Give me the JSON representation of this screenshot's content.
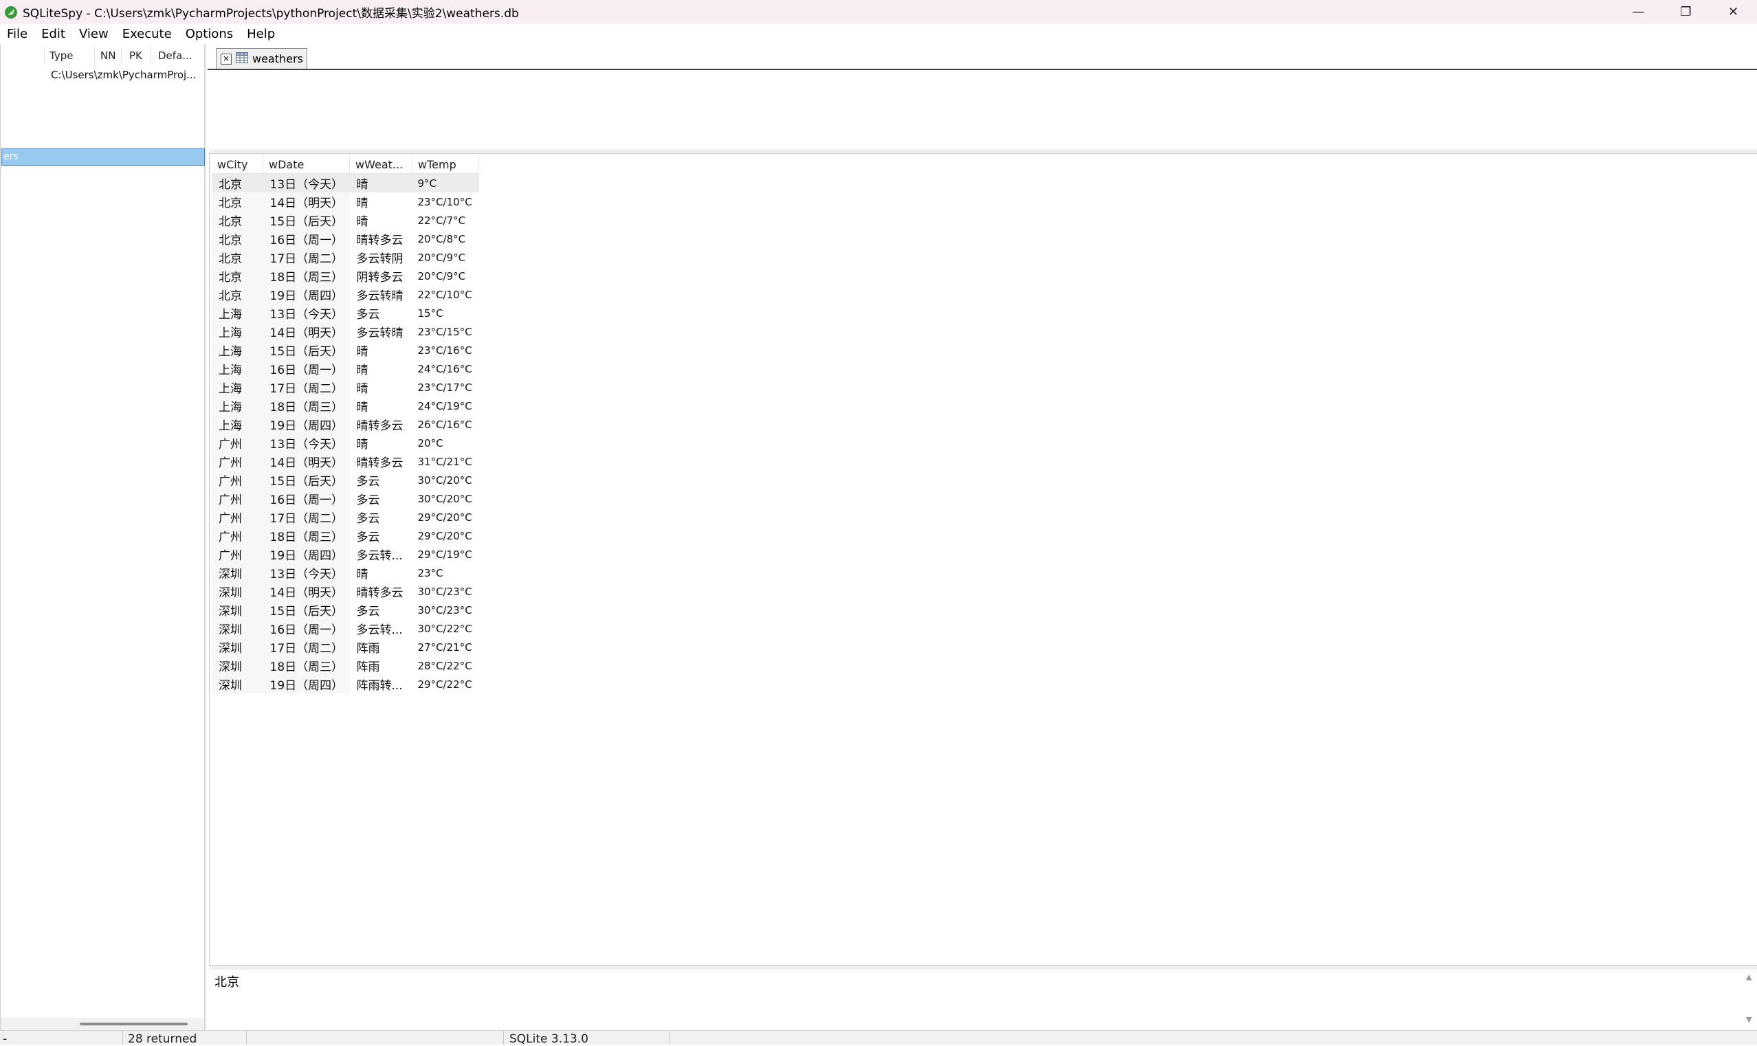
{
  "window": {
    "title": "SQLiteSpy - C:\\Users\\zmk\\PycharmProjects\\pythonProject\\数据采集\\实验2\\weathers.db",
    "minimize_glyph": "—",
    "restore_glyph": "❐",
    "close_glyph": "✕"
  },
  "menu": {
    "items": [
      "File",
      "Edit",
      "View",
      "Execute",
      "Options",
      "Help"
    ]
  },
  "left_pane": {
    "columns": [
      "Type",
      "NN",
      "PK",
      "Defa..."
    ],
    "path": "C:\\Users\\zmk\\PycharmProj...",
    "selected_item": "ers"
  },
  "tab": {
    "close_glyph": "×",
    "label": "weathers"
  },
  "grid": {
    "headers": [
      "wCity",
      "wDate",
      "wWeat...",
      "wTemp"
    ],
    "rows": [
      [
        "北京",
        "13日（今天）",
        "晴",
        "9°C"
      ],
      [
        "北京",
        "14日（明天）",
        "晴",
        "23°C/10°C"
      ],
      [
        "北京",
        "15日（后天）",
        "晴",
        "22°C/7°C"
      ],
      [
        "北京",
        "16日（周一）",
        "晴转多云",
        "20°C/8°C"
      ],
      [
        "北京",
        "17日（周二）",
        "多云转阴",
        "20°C/9°C"
      ],
      [
        "北京",
        "18日（周三）",
        "阴转多云",
        "20°C/9°C"
      ],
      [
        "北京",
        "19日（周四）",
        "多云转晴",
        "22°C/10°C"
      ],
      [
        "上海",
        "13日（今天）",
        "多云",
        "15°C"
      ],
      [
        "上海",
        "14日（明天）",
        "多云转晴",
        "23°C/15°C"
      ],
      [
        "上海",
        "15日（后天）",
        "晴",
        "23°C/16°C"
      ],
      [
        "上海",
        "16日（周一）",
        "晴",
        "24°C/16°C"
      ],
      [
        "上海",
        "17日（周二）",
        "晴",
        "23°C/17°C"
      ],
      [
        "上海",
        "18日（周三）",
        "晴",
        "24°C/19°C"
      ],
      [
        "上海",
        "19日（周四）",
        "晴转多云",
        "26°C/16°C"
      ],
      [
        "广州",
        "13日（今天）",
        "晴",
        "20°C"
      ],
      [
        "广州",
        "14日（明天）",
        "晴转多云",
        "31°C/21°C"
      ],
      [
        "广州",
        "15日（后天）",
        "多云",
        "30°C/20°C"
      ],
      [
        "广州",
        "16日（周一）",
        "多云",
        "30°C/20°C"
      ],
      [
        "广州",
        "17日（周二）",
        "多云",
        "29°C/20°C"
      ],
      [
        "广州",
        "18日（周三）",
        "多云",
        "29°C/20°C"
      ],
      [
        "广州",
        "19日（周四）",
        "多云转...",
        "29°C/19°C"
      ],
      [
        "深圳",
        "13日（今天）",
        "晴",
        "23°C"
      ],
      [
        "深圳",
        "14日（明天）",
        "晴转多云",
        "30°C/23°C"
      ],
      [
        "深圳",
        "15日（后天）",
        "多云",
        "30°C/23°C"
      ],
      [
        "深圳",
        "16日（周一）",
        "多云转...",
        "30°C/22°C"
      ],
      [
        "深圳",
        "17日（周二）",
        "阵雨",
        "27°C/21°C"
      ],
      [
        "深圳",
        "18日（周三）",
        "阵雨",
        "28°C/22°C"
      ],
      [
        "深圳",
        "19日（周四）",
        "阵雨转...",
        "29°C/22°C"
      ]
    ]
  },
  "detail": {
    "value": "北京",
    "scroll_up_glyph": "▲",
    "scroll_down_glyph": "▼"
  },
  "status": {
    "first": "-",
    "rows_returned": "28 returned",
    "version": "SQLite 3.13.0"
  }
}
